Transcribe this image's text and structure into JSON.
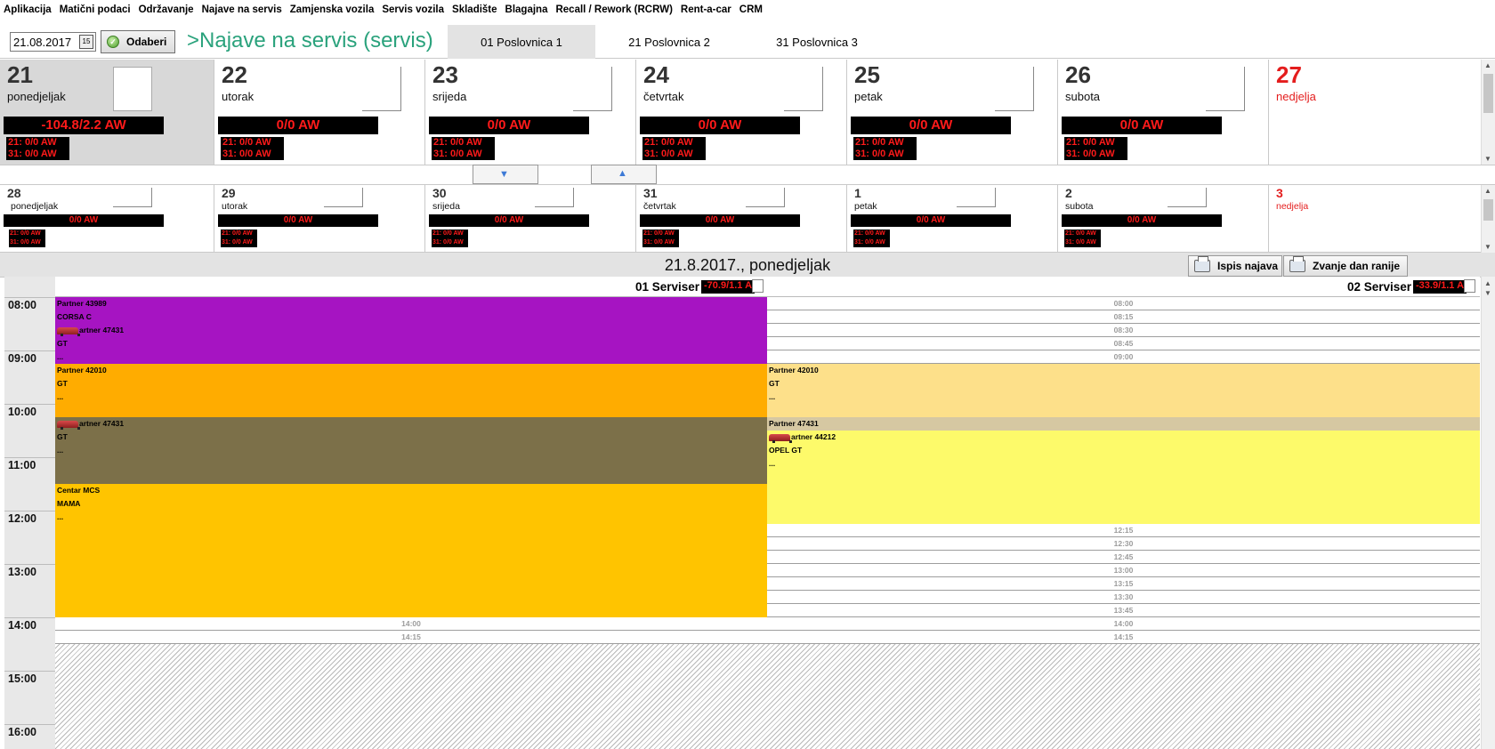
{
  "menu": [
    "Aplikacija",
    "Matični podaci",
    "Održavanje",
    "Najave na servis",
    "Zamjenska vozila",
    "Servis vozila",
    "Skladište",
    "Blagajna",
    "Recall / Rework (RCRW)",
    "Rent-a-car",
    "CRM"
  ],
  "toolbar": {
    "date_value": "21.08.2017",
    "calendar_glyph": "15",
    "select_label": "Odaberi",
    "title": ">Najave na servis (servis)",
    "tabs": [
      "01 Poslovnica 1",
      "21 Poslovnica 2",
      "31 Poslovnica 3"
    ]
  },
  "week1": [
    {
      "num": "21",
      "name": "ponedjeljak",
      "aw": "-104.8/2.2 AW",
      "l1": "21: 0/0 AW",
      "l2": "31: 0/0 AW"
    },
    {
      "num": "22",
      "name": "utorak",
      "aw": "0/0 AW",
      "l1": "21: 0/0 AW",
      "l2": "31: 0/0 AW"
    },
    {
      "num": "23",
      "name": "srijeda",
      "aw": "0/0 AW",
      "l1": "21: 0/0 AW",
      "l2": "31: 0/0 AW"
    },
    {
      "num": "24",
      "name": "četvrtak",
      "aw": "0/0 AW",
      "l1": "21: 0/0 AW",
      "l2": "31: 0/0 AW"
    },
    {
      "num": "25",
      "name": "petak",
      "aw": "0/0 AW",
      "l1": "21: 0/0 AW",
      "l2": "31: 0/0 AW"
    },
    {
      "num": "26",
      "name": "subota",
      "aw": "0/0 AW",
      "l1": "21: 0/0 AW",
      "l2": "31: 0/0 AW"
    },
    {
      "num": "27",
      "name": "nedjelja"
    }
  ],
  "week2": [
    {
      "num": "28",
      "name": "ponedjeljak",
      "aw": "0/0 AW",
      "l1": "21: 0/0 AW",
      "l2": "31: 0/0 AW"
    },
    {
      "num": "29",
      "name": "utorak",
      "aw": "0/0 AW",
      "l1": "21: 0/0 AW",
      "l2": "31: 0/0 AW"
    },
    {
      "num": "30",
      "name": "srijeda",
      "aw": "0/0 AW",
      "l1": "21: 0/0 AW",
      "l2": "31: 0/0 AW"
    },
    {
      "num": "31",
      "name": "četvrtak",
      "aw": "0/0 AW",
      "l1": "21: 0/0 AW",
      "l2": "31: 0/0 AW"
    },
    {
      "num": "1",
      "name": "petak",
      "aw": "0/0 AW",
      "l1": "21: 0/0 AW",
      "l2": "31: 0/0 AW"
    },
    {
      "num": "2",
      "name": "subota",
      "aw": "0/0 AW",
      "l1": "21: 0/0 AW",
      "l2": "31: 0/0 AW"
    },
    {
      "num": "3",
      "name": "nedjelja"
    }
  ],
  "schedule": {
    "date_label": "21.8.2017., ponedjeljak",
    "print_label": "Ispis najava",
    "call_label": "Zvanje dan ranije",
    "hours": [
      "08:00",
      "09:00",
      "10:00",
      "11:00",
      "12:00",
      "13:00",
      "14:00",
      "15:00",
      "16:00"
    ],
    "col1": {
      "name": "01 Serviser",
      "aw": "-70.9/1.1 A"
    },
    "col2": {
      "name": "02 Serviser",
      "aw": "-33.9/1.1 A"
    }
  },
  "appointments": {
    "a1": [
      "Partner 43989",
      "CORSA C",
      "artner 47431",
      "GT",
      "..."
    ],
    "a2": [
      "Partner 42010",
      "GT",
      "..."
    ],
    "a3": [
      "artner 47431",
      "GT",
      "..."
    ],
    "a4": [
      "Centar MCS",
      "MAMA",
      "..."
    ],
    "b1": [
      "Partner 42010",
      "GT",
      "..."
    ],
    "b2": [
      "Partner 47431"
    ],
    "b3": [
      "artner 44212",
      "OPEL GT",
      "..."
    ]
  },
  "free_slots": {
    "col2_morning": [
      "08:00",
      "08:15",
      "08:30",
      "08:45",
      "09:00"
    ],
    "col2_afternoon": [
      "12:15",
      "12:30",
      "12:45",
      "13:00",
      "13:15",
      "13:30",
      "13:45",
      "14:00",
      "14:15"
    ],
    "col1_afternoon": [
      "14:00",
      "14:15"
    ]
  },
  "colors": {
    "purple": "#a614c2",
    "orange": "#ffac00",
    "olive": "#7c7049",
    "amber": "#ffc400",
    "light_amber": "#fde08a",
    "tan": "#d6c8a2",
    "yellow": "#fdfa6a",
    "title_green": "#2aa27c",
    "aw_red": "#ff1a1a"
  }
}
